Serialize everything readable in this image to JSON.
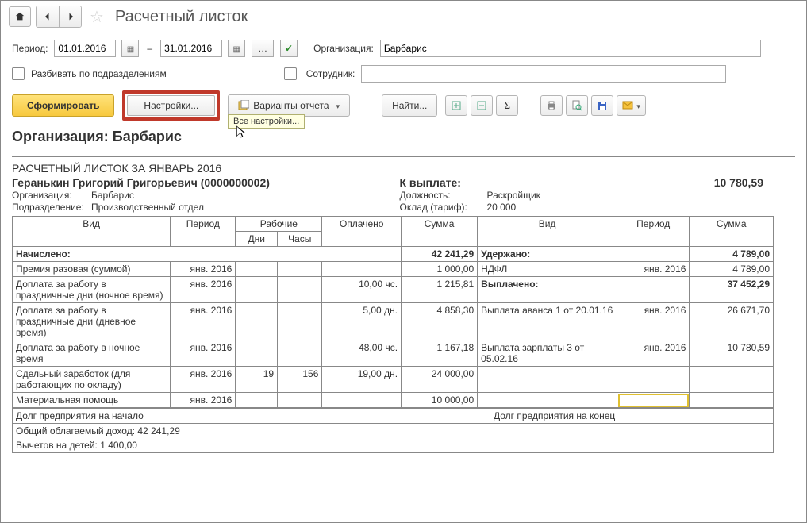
{
  "page_title": "Расчетный листок",
  "period": {
    "label": "Период:",
    "date_from": "01.01.2016",
    "dash": "–",
    "date_to": "31.01.2016"
  },
  "org_field": {
    "label": "Организация:",
    "value": "Барбарис"
  },
  "split_by_dept": {
    "label": "Разбивать по подразделениям"
  },
  "employee_field": {
    "label": "Сотрудник:"
  },
  "toolbar": {
    "generate": "Сформировать",
    "settings": "Настройки...",
    "settings_tooltip": "Все настройки...",
    "variants": "Варианты отчета",
    "find": "Найти..."
  },
  "report": {
    "org_heading": "Организация: Барбарис",
    "title": "РАСЧЕТНЫЙ ЛИСТОК ЗА ЯНВАРЬ 2016",
    "employee_name": "Геранькин Григорий Григорьевич (0000000002)",
    "info": {
      "org_label": "Организация:",
      "org_value": "Барбарис",
      "dept_label": "Подразделение:",
      "dept_value": "Производственный отдел",
      "payout_label": "К выплате:",
      "payout_value": "10 780,59",
      "position_label": "Должность:",
      "position_value": "Раскройщик",
      "salary_label": "Оклад (тариф):",
      "salary_value": "20 000"
    },
    "headers": {
      "left": {
        "type": "Вид",
        "period": "Период",
        "work": "Рабочие",
        "days": "Дни",
        "hours": "Часы",
        "paid": "Оплачено",
        "sum": "Сумма"
      },
      "right": {
        "type": "Вид",
        "period": "Период",
        "sum": "Сумма"
      }
    },
    "sections": {
      "accrued_label": "Начислено:",
      "accrued_total": "42 241,29",
      "withheld_label": "Удержано:",
      "withheld_total": "4 789,00",
      "paid_out_label": "Выплачено:",
      "paid_out_total": "37 452,29"
    },
    "left_rows": [
      {
        "name": "Премия разовая (суммой)",
        "period": "янв. 2016",
        "days": "",
        "hours": "",
        "paid": "",
        "sum": "1 000,00"
      },
      {
        "name": "Доплата за работу в праздничные дни (ночное время)",
        "period": "янв. 2016",
        "days": "",
        "hours": "",
        "paid": "10,00 чс.",
        "sum": "1 215,81"
      },
      {
        "name": "Доплата за работу в праздничные дни (дневное время)",
        "period": "янв. 2016",
        "days": "",
        "hours": "",
        "paid": "5,00 дн.",
        "sum": "4 858,30"
      },
      {
        "name": "Доплата за работу в ночное время",
        "period": "янв. 2016",
        "days": "",
        "hours": "",
        "paid": "48,00 чс.",
        "sum": "1 167,18"
      },
      {
        "name": "Сдельный заработок (для работающих по окладу)",
        "period": "янв. 2016",
        "days": "19",
        "hours": "156",
        "paid": "19,00 дн.",
        "sum": "24 000,00"
      },
      {
        "name": "Материальная помощь",
        "period": "янв. 2016",
        "days": "",
        "hours": "",
        "paid": "",
        "sum": "10 000,00"
      }
    ],
    "right_rows": [
      {
        "name": "НДФЛ",
        "period": "янв. 2016",
        "sum": "4 789,00"
      },
      {
        "name": "Выплата аванса 1 от 20.01.16",
        "period": "янв. 2016",
        "sum": "26 671,70"
      },
      {
        "name": "Выплата зарплаты 3 от 05.02.16",
        "period": "янв. 2016",
        "sum": "10 780,59"
      }
    ],
    "footer": {
      "debt_start": "Долг предприятия на начало",
      "debt_end": "Долг предприятия на конец",
      "taxable": "Общий облагаемый доход:  42 241,29",
      "deductions": "Вычетов на детей:  1 400,00"
    }
  }
}
